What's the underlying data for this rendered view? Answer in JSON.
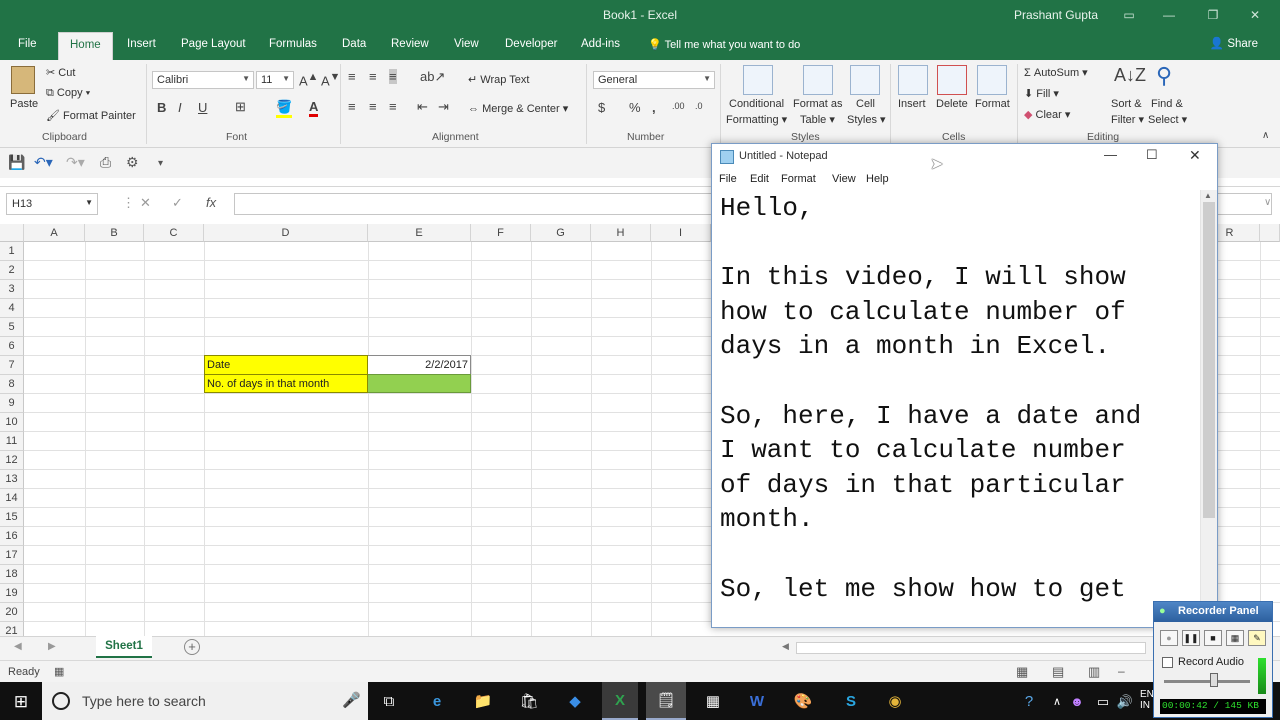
{
  "excel": {
    "window_title": "Book1  -  Excel",
    "user": "Prashant Gupta",
    "tabs": [
      "File",
      "Home",
      "Insert",
      "Page Layout",
      "Formulas",
      "Data",
      "Review",
      "View",
      "Developer",
      "Add-ins"
    ],
    "active_tab": "Home",
    "tell_me": "Tell me what you want to do",
    "share": "Share",
    "ribbon": {
      "clipboard": {
        "paste": "Paste",
        "cut": "Cut",
        "copy": "Copy",
        "format_painter": "Format Painter",
        "label": "Clipboard"
      },
      "font": {
        "name": "Calibri",
        "size": "11",
        "bold": "B",
        "italic": "I",
        "underline": "U",
        "label": "Font"
      },
      "alignment": {
        "wrap_text": "Wrap Text",
        "merge_center": "Merge & Center",
        "label": "Alignment"
      },
      "number": {
        "format": "General",
        "currency": "$",
        "percent": "%",
        "comma": ",",
        "label": "Number"
      },
      "styles": {
        "conditional": [
          "Conditional",
          "Formatting"
        ],
        "format_table": [
          "Format as",
          "Table"
        ],
        "cell_styles": [
          "Cell",
          "Styles"
        ],
        "label": "Styles"
      },
      "cells": {
        "insert": "Insert",
        "delete": "Delete",
        "format": "Format",
        "label": "Cells"
      },
      "editing": {
        "autosum": "AutoSum",
        "fill": "Fill",
        "clear": "Clear",
        "sort_filter": [
          "Sort &",
          "Filter"
        ],
        "find_select": [
          "Find &",
          "Select"
        ],
        "label": "Editing"
      }
    },
    "name_box": "H13",
    "fx": "fx",
    "columns": [
      "A",
      "B",
      "C",
      "D",
      "E",
      "F",
      "G",
      "H",
      "I",
      "R"
    ],
    "rows": [
      "1",
      "2",
      "3",
      "4",
      "5",
      "6",
      "7",
      "8",
      "9",
      "10",
      "11",
      "12",
      "13",
      "14",
      "15",
      "16",
      "17",
      "18",
      "19",
      "20",
      "21"
    ],
    "cells": {
      "D7": "Date",
      "E7": "2/2/2017",
      "D8": "No. of days in that month"
    },
    "colors": {
      "accent": "#217346",
      "label_fill": "#ffff00",
      "result_fill": "#92d050"
    },
    "sheet_tab": "Sheet1",
    "status": "Ready"
  },
  "notepad": {
    "title": "Untitled - Notepad",
    "menu": [
      "File",
      "Edit",
      "Format",
      "View",
      "Help"
    ],
    "text": "Hello,\n\nIn this video, I will show\nhow to calculate number of\ndays in a month in Excel.\n\nSo, here, I have a date and\nI want to calculate number\nof days in that particular\nmonth.\n\nSo, let me show how to get "
  },
  "recorder": {
    "title": "Recorder Panel",
    "record_audio": "Record Audio",
    "status": "00:00:42 / 145 KB"
  },
  "taskbar": {
    "search_placeholder": "Type here to search",
    "tray": "EN\nIN"
  }
}
